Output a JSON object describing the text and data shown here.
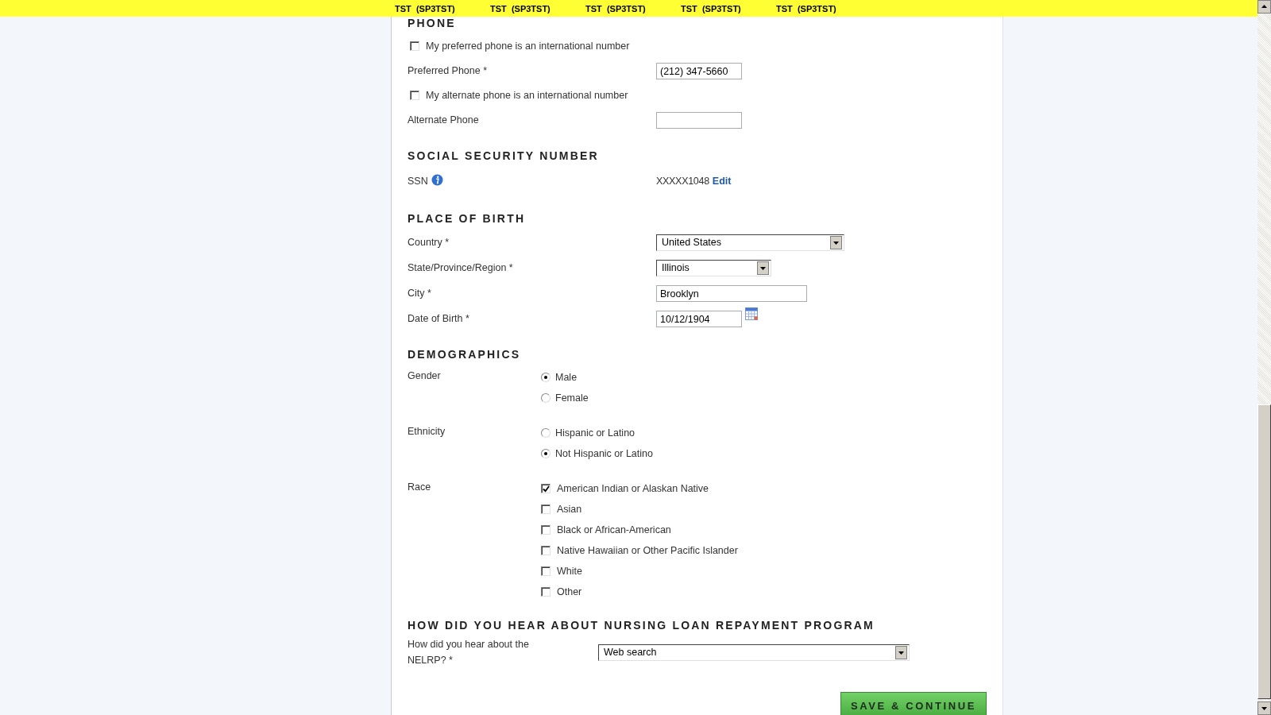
{
  "banner": [
    "TST  (SP3TST)",
    "TST  (SP3TST)",
    "TST  (SP3TST)",
    "TST  (SP3TST)",
    "TST  (SP3TST)"
  ],
  "sections": [
    {
      "heading": "PHONE",
      "rows": [
        {
          "kind": "checkbox",
          "label": "My preferred phone is an international number",
          "checked": false
        },
        {
          "kind": "text",
          "label": "Preferred Phone *",
          "value": "(212) 347-5660"
        },
        {
          "kind": "checkbox",
          "label": "My alternate phone is an international number",
          "checked": false
        },
        {
          "kind": "text",
          "label": "Alternate Phone"
        }
      ]
    },
    {
      "heading": "SOCIAL SECURITY NUMBER",
      "rows": [
        {
          "kind": "ssn",
          "label": "SSN",
          "value": "XXXXX1048",
          "link": "Edit"
        }
      ]
    },
    {
      "heading": "PLACE OF BIRTH",
      "rows": [
        {
          "kind": "select",
          "label": "Country *",
          "value": "United States"
        },
        {
          "kind": "select",
          "label": "State/Province/Region *",
          "value": "Illinois"
        },
        {
          "kind": "text",
          "label": "City *",
          "value": "Brooklyn"
        },
        {
          "kind": "date",
          "label": "Date of Birth *",
          "value": "10/12/1904"
        }
      ]
    },
    {
      "heading": "DEMOGRAPHICS",
      "rows": [
        {
          "kind": "radio-group",
          "label": "Gender",
          "options": [
            {
              "label": "Male",
              "selected": true
            },
            {
              "label": "Female",
              "selected": false
            }
          ]
        },
        {
          "kind": "radio-group",
          "label": "Ethnicity",
          "options": [
            {
              "label": "Hispanic or Latino",
              "selected": false
            },
            {
              "label": "Not Hispanic or Latino",
              "selected": true
            }
          ]
        },
        {
          "kind": "checkbox-group",
          "label": "Race",
          "options": [
            {
              "label": "American Indian or Alaskan Native",
              "checked": true
            },
            {
              "label": "Asian",
              "checked": false
            },
            {
              "label": "Black or African-American",
              "checked": false
            },
            {
              "label": "Native Hawaiian or Other Pacific Islander",
              "checked": false
            },
            {
              "label": "White",
              "checked": false
            },
            {
              "label": "Other",
              "checked": false
            }
          ]
        }
      ]
    },
    {
      "heading": "HOW DID YOU HEAR ABOUT NURSING LOAN REPAYMENT PROGRAM",
      "rows": [
        {
          "kind": "select",
          "label": "How did you hear about the NELRP? *",
          "value": "Web search"
        }
      ]
    }
  ],
  "save_button": "SAVE & CONTINUE"
}
